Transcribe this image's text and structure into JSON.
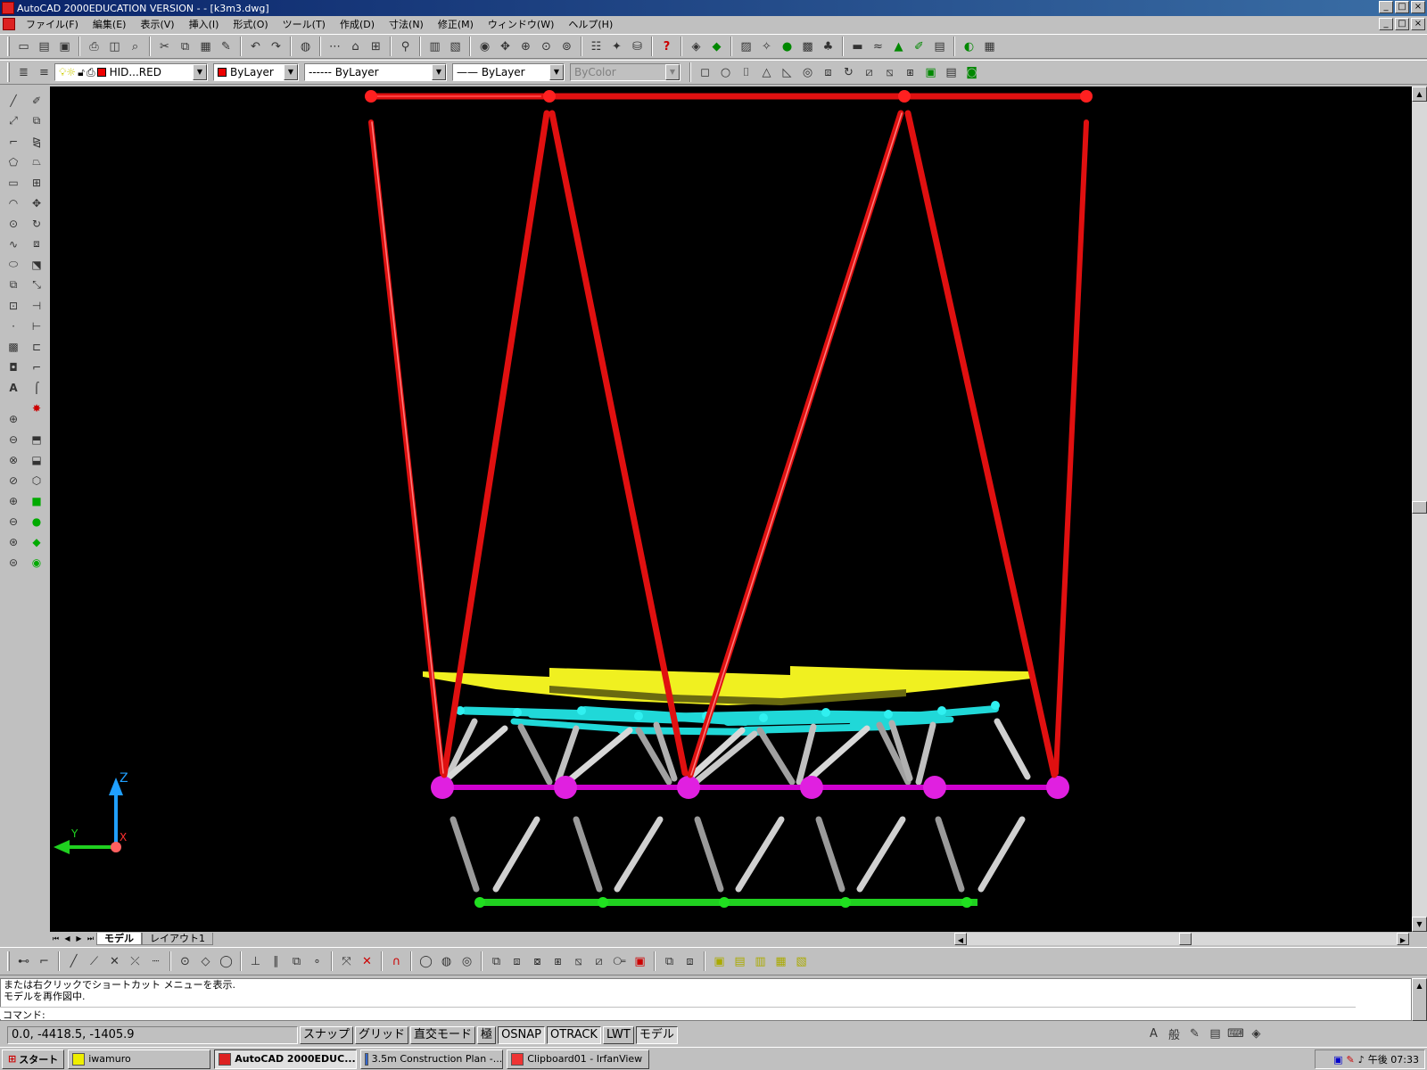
{
  "window": {
    "title": "AutoCAD 2000EDUCATION VERSION - - [k3m3.dwg]",
    "min": "_",
    "max": "□",
    "close": "×"
  },
  "menu": [
    "ファイル(F)",
    "編集(E)",
    "表示(V)",
    "挿入(I)",
    "形式(O)",
    "ツール(T)",
    "作成(D)",
    "寸法(N)",
    "修正(M)",
    "ウィンドウ(W)",
    "ヘルプ(H)"
  ],
  "properties": {
    "layer": "HID...RED",
    "color": "ByLayer",
    "linetype": "------ ByLayer",
    "lineweight": "—— ByLayer",
    "plotstyle": "ByColor"
  },
  "tabs": {
    "model": "モデル",
    "layout": "レイアウト1"
  },
  "command": {
    "history": [
      "または右クリックでショートカット メニューを表示.",
      "モデルを再作図中."
    ],
    "prompt": "コマンド:"
  },
  "status": {
    "coords": "0.0, -4418.5, -1405.9",
    "buttons": [
      "スナップ",
      "グリッド",
      "直交モード",
      "極",
      "OSNAP",
      "OTRACK",
      "LWT",
      "モデル"
    ],
    "active": [
      "OSNAP",
      "OTRACK",
      "モデル"
    ]
  },
  "taskbar": {
    "start": "スタート",
    "tasks": [
      "iwamuro",
      "AutoCAD 2000EDUC...",
      "3.5m Construction Plan -...",
      "Clipboard01 - IrfanView"
    ],
    "clock": "午後 07:33"
  },
  "ucs": {
    "z": "Z",
    "y": "Y",
    "x": "X"
  },
  "colors": {
    "cable": "#ff2020",
    "node": "#e000e0",
    "deck": "#f0f020",
    "cyan": "#20e0e0",
    "green": "#20d020",
    "strut": "#b0b0b0"
  }
}
